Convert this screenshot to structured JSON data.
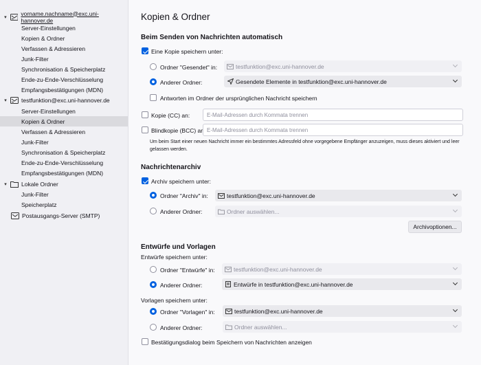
{
  "sidebar": {
    "accounts": [
      {
        "label": "vorname.nachname@exc.uni-hannover.de",
        "icon": "mail-account-icon",
        "items": [
          "Server-Einstellungen",
          "Kopien & Ordner",
          "Verfassen & Adressieren",
          "Junk-Filter",
          "Synchronisation & Speicherplatz",
          "Ende-zu-Ende-Verschlüsselung",
          "Empfangsbestätigungen (MDN)"
        ]
      },
      {
        "label": "testfunktion@exc.uni-hannover.de",
        "icon": "mail-account-icon",
        "items": [
          "Server-Einstellungen",
          "Kopien & Ordner",
          "Verfassen & Adressieren",
          "Junk-Filter",
          "Synchronisation & Speicherplatz",
          "Ende-zu-Ende-Verschlüsselung",
          "Empfangsbestätigungen (MDN)"
        ]
      },
      {
        "label": "Lokale Ordner",
        "icon": "folder-icon",
        "items": [
          "Junk-Filter",
          "Speicherplatz"
        ]
      }
    ],
    "outgoing": "Postausgangs-Server (SMTP)",
    "selected": "testfunktion@exc.uni-hannover.de / Kopien & Ordner"
  },
  "page_title": "Kopien & Ordner",
  "send": {
    "heading": "Beim Senden von Nachrichten automatisch",
    "save_copy": "Eine Kopie speichern unter:",
    "folder_sent_label": "Ordner \"Gesendet\" in:",
    "folder_sent_value": "testfunktion@exc.uni-hannover.de",
    "other_folder_label": "Anderer Ordner:",
    "other_folder_value": "Gesendete Elemente in testfunktion@exc.uni-hannover.de",
    "reply_in_folder": "Antworten im Ordner der ursprünglichen Nachricht speichern",
    "cc_label": "Kopie (CC) an:",
    "cc_placeholder": "E-Mail-Adressen durch Kommata trennen",
    "bcc_label": "Blindkopie (BCC) an:",
    "bcc_placeholder": "E-Mail-Adressen durch Kommata trennen",
    "note": "Um beim Start einer neuen Nachricht immer ein bestimmtes Adressfeld ohne vorgegebene Empfänger anzuzeigen, muss dieses aktiviert und leer gelassen werden."
  },
  "archive": {
    "heading": "Nachrichtenarchiv",
    "save_label": "Archiv speichern unter:",
    "folder_label": "Ordner \"Archiv\" in:",
    "folder_value": "testfunktion@exc.uni-hannover.de",
    "other_label": "Anderer Ordner:",
    "other_placeholder": "Ordner auswählen...",
    "options_button": "Archivoptionen..."
  },
  "drafts": {
    "heading": "Entwürfe und Vorlagen",
    "drafts_label": "Entwürfe speichern unter:",
    "drafts_folder_label": "Ordner \"Entwürfe\" in:",
    "drafts_folder_value": "testfunktion@exc.uni-hannover.de",
    "drafts_other_label": "Anderer Ordner:",
    "drafts_other_value": "Entwürfe in testfunktion@exc.uni-hannover.de",
    "templates_label": "Vorlagen speichern unter:",
    "templates_folder_label": "Ordner \"Vorlagen\" in:",
    "templates_folder_value": "testfunktion@exc.uni-hannover.de",
    "templates_other_label": "Anderer Ordner:",
    "templates_other_placeholder": "Ordner auswählen...",
    "confirm": "Bestätigungsdialog beim Speichern von Nachrichten anzeigen"
  },
  "colors": {
    "accent": "#0061e0",
    "sidebar_bg": "#f0f0f4",
    "selected_bg": "#dadade"
  }
}
